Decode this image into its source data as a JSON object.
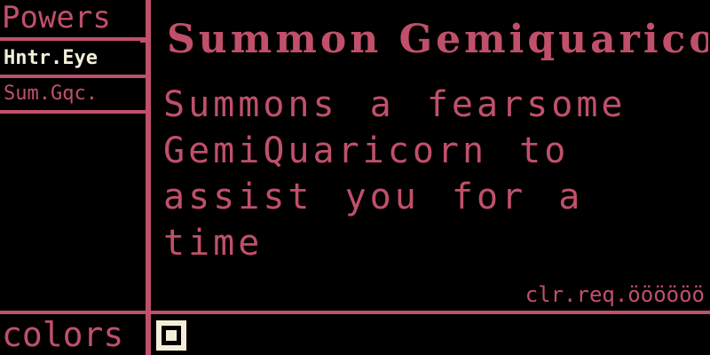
{
  "colors": {
    "accent": "#c0506a",
    "highlight": "#f4eed8",
    "background": "#000000"
  },
  "menu": {
    "title": "Powers",
    "items": [
      {
        "label": "Hntr.Eye",
        "selected": true
      },
      {
        "label": "Sum.Gqc.",
        "selected": false
      }
    ]
  },
  "detail": {
    "title": "Summon Gemiquaricorn",
    "description": "Summons a fearsome GemiQuaricorn to assist you for a time",
    "cooldown": "clr.req.öööööö"
  },
  "footer": {
    "colors_label": "colors",
    "swatch_icon": "square-swatch-icon"
  }
}
